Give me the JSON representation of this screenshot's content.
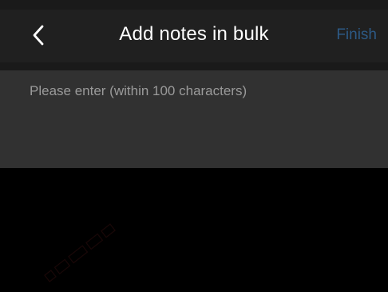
{
  "header": {
    "title": "Add notes in bulk",
    "finish_label": "Finish",
    "back_icon": "chevron-left-icon"
  },
  "notes": {
    "value": "",
    "placeholder": "Please enter (within 100 characters)"
  },
  "colors": {
    "background": "#000000",
    "header_background": "#202020",
    "input_background": "#313131",
    "title_text": "#ffffff",
    "finish_text": "#2d5a86",
    "placeholder_text": "#9a9a9a"
  }
}
